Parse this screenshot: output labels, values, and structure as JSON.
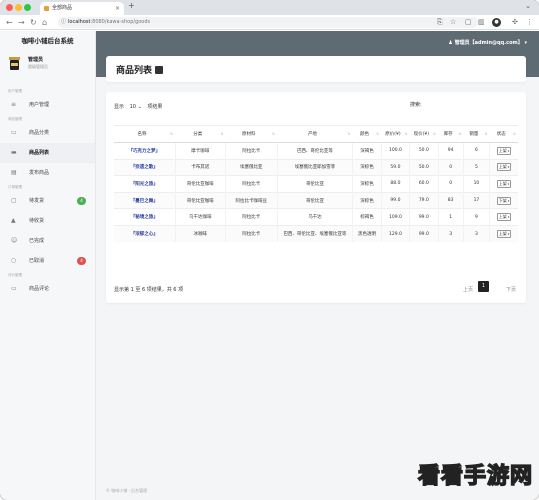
{
  "browser": {
    "tab_title": "全部商品",
    "url_host": "localhost",
    "url_path": ":8080/kawa-shop/goods"
  },
  "app": {
    "brand": "咖啡小铺后台系统",
    "user_name": "管理员",
    "user_role": "超级管理员",
    "header_user": "管理员【admin@qq.com】"
  },
  "sidebar": {
    "groups": [
      {
        "label": "用户管理"
      },
      {
        "label": "商品管理"
      },
      {
        "label": "订单管理"
      },
      {
        "label": "评价管理"
      }
    ],
    "items": [
      {
        "label": "用户管理",
        "icon": "sliders-icon"
      },
      {
        "label": "商品分类",
        "icon": "folder-icon"
      },
      {
        "label": "商品列表",
        "icon": "list-icon"
      },
      {
        "label": "发布商品",
        "icon": "edit-icon"
      },
      {
        "label": "待发货",
        "icon": "box-icon",
        "badge": "4"
      },
      {
        "label": "待收货",
        "icon": "truck-icon"
      },
      {
        "label": "已完成",
        "icon": "check-icon"
      },
      {
        "label": "已取消",
        "icon": "cancel-icon",
        "badge": "4"
      },
      {
        "label": "商品评论",
        "icon": "comment-icon"
      }
    ]
  },
  "page": {
    "title": "商品列表"
  },
  "table_controls": {
    "show_label": "显示",
    "page_size": "10",
    "results_label": "项结果",
    "search_label": "搜索:"
  },
  "table": {
    "headers": [
      "名称",
      "分类",
      "原材料",
      "产地",
      "颜色",
      "原价(¥)",
      "现价(¥)",
      "库存",
      "销量",
      "状态"
    ],
    "rows": [
      [
        "『巧克力之梦』",
        "摩卡咖啡",
        "阿拉比卡",
        "巴西、哥伦比亚等",
        "深褐色",
        "100.0",
        "50.0",
        "94",
        "6",
        "上架"
      ],
      [
        "『奈遗之歌』",
        "卡布其诺",
        "埃塞俄比亚",
        "埃塞俄比亚耶加雪菲",
        "深棕色",
        "59.0",
        "50.0",
        "0",
        "5",
        "上架"
      ],
      [
        "『阳光之旅』",
        "哥伦比亚咖啡",
        "阿拉比卡",
        "哥伦比亚",
        "深棕色",
        "88.0",
        "60.0",
        "0",
        "10",
        "上架"
      ],
      [
        "『曼巴之舞』",
        "哥伦比亚咖啡",
        "阿拉比卡咖啡豆",
        "哥伦比亚",
        "深棕色",
        "99.0",
        "79.0",
        "83",
        "17",
        "下架"
      ],
      [
        "『秘境之旅』",
        "乌干达咖啡",
        "阿拉比卡",
        "乌干达",
        "棕褐色",
        "109.0",
        "99.0",
        "1",
        "9",
        "上架"
      ],
      [
        "『浓郁之心』",
        "冰咖啡",
        "阿拉比卡",
        "巴西、哥伦比亚、埃塞俄比亚等",
        "黑色透明",
        "129.0",
        "99.0",
        "3",
        "3",
        "上架"
      ]
    ]
  },
  "pager": {
    "info": "显示第 1 至 6 项结果，共 6 项",
    "prev": "上页",
    "current": "1",
    "next": "下页"
  },
  "footer": {
    "text": "© 咖啡小铺 · 后台管理"
  },
  "watermark": {
    "text": "看看手游网"
  },
  "colors": {
    "header_band": "#5f6b73",
    "link_blue": "#2b3d9f",
    "badge_green": "#4caf50",
    "badge_red": "#e05252"
  }
}
